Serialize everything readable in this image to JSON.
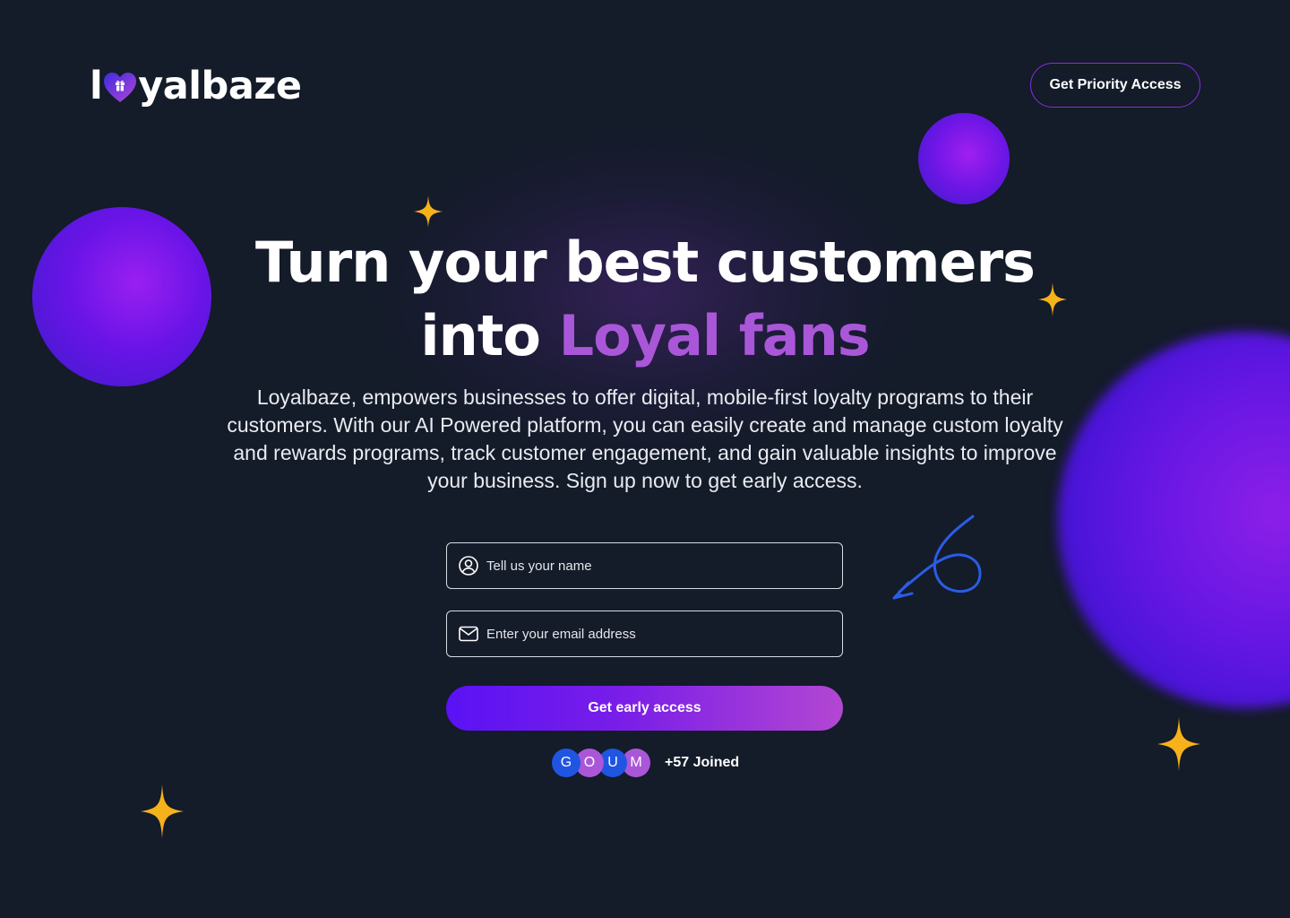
{
  "header": {
    "logo_prefix": "l",
    "logo_suffix": "yalbaze",
    "priority_button_label": "Get Priority Access"
  },
  "hero": {
    "headline_line1": "Turn your best customers",
    "headline_into": "into",
    "headline_accent": "Loyal fans",
    "description": "Loyalbaze, empowers businesses to offer digital, mobile-first loyalty programs to their customers. With our AI Powered platform, you can easily create and manage custom loyalty and rewards programs, track customer engagement, and gain valuable insights to improve your business. Sign up now to get early access."
  },
  "form": {
    "name_placeholder": "Tell us your name",
    "email_placeholder": "Enter your email address",
    "cta_label": "Get early access"
  },
  "social_proof": {
    "avatars": [
      {
        "initial": "G",
        "color": "#1f55e0"
      },
      {
        "initial": "O",
        "color": "#a957d8"
      },
      {
        "initial": "U",
        "color": "#1f55e0"
      },
      {
        "initial": "M",
        "color": "#a957d8"
      }
    ],
    "joined_text": "+57 Joined"
  },
  "colors": {
    "background": "#141b29",
    "accent_purple": "#a957d8",
    "star_yellow": "#f6b21b",
    "arrow_blue": "#2b5ce6"
  },
  "icons": [
    "heart-gift-icon",
    "user-circle-icon",
    "envelope-icon",
    "sparkle-star-icon",
    "curly-arrow-icon"
  ]
}
